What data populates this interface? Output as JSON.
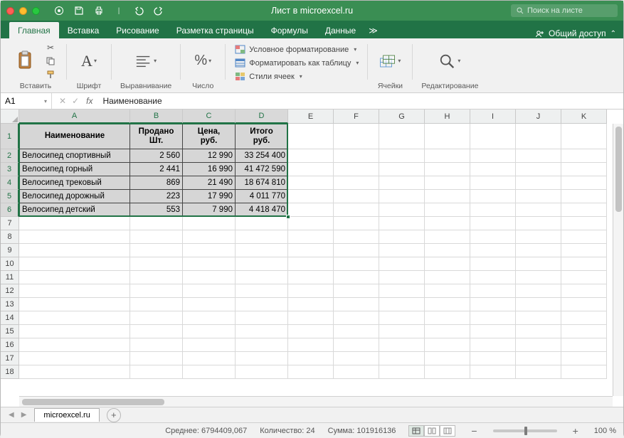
{
  "titlebar": {
    "title": "Лист в microexcel.ru",
    "search_placeholder": "Поиск на листе"
  },
  "tabs": {
    "items": [
      "Главная",
      "Вставка",
      "Рисование",
      "Разметка страницы",
      "Формулы",
      "Данные"
    ],
    "active": 0,
    "share": "Общий доступ"
  },
  "ribbon": {
    "paste": "Вставить",
    "font": "Шрифт",
    "alignment": "Выравнивание",
    "number": "Число",
    "cond_format": "Условное форматирование",
    "format_table": "Форматировать как таблицу",
    "cell_styles": "Стили ячеек",
    "cells": "Ячейки",
    "editing": "Редактирование"
  },
  "fbar": {
    "name": "A1",
    "fx": "fx",
    "value": "Наименование"
  },
  "columns": [
    "A",
    "B",
    "C",
    "D",
    "E",
    "F",
    "G",
    "H",
    "I",
    "J",
    "K"
  ],
  "row_numbers": [
    1,
    2,
    3,
    4,
    5,
    6,
    7,
    8,
    9,
    10,
    11,
    12,
    13,
    14,
    15,
    16,
    17,
    18
  ],
  "table": {
    "headers": [
      "Наименование",
      "Продано Шт.",
      "Цена, руб.",
      "Итого руб."
    ],
    "rows": [
      [
        "Велосипед спортивный",
        "2 560",
        "12 990",
        "33 254 400"
      ],
      [
        "Велосипед горный",
        "2 441",
        "16 990",
        "41 472 590"
      ],
      [
        "Велосипед трековый",
        "869",
        "21 490",
        "18 674 810"
      ],
      [
        "Велосипед дорожный",
        "223",
        "17 990",
        "4 011 770"
      ],
      [
        "Велосипед детский",
        "553",
        "7 990",
        "4 418 470"
      ]
    ]
  },
  "sheet_tab": "microexcel.ru",
  "status": {
    "avg_label": "Среднее:",
    "avg": "6794409,067",
    "count_label": "Количество:",
    "count": "24",
    "sum_label": "Сумма:",
    "sum": "101916136",
    "zoom": "100 %"
  }
}
